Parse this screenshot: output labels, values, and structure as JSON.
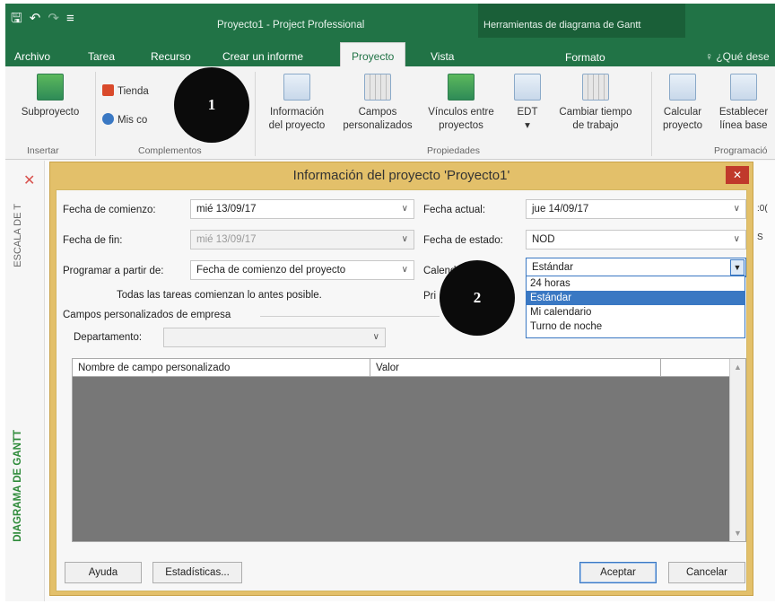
{
  "app": {
    "window_title": "Proyecto1 - Project Professional",
    "contextual_title": "Herramientas de diagrama de Gantt",
    "contextual_tab": "Formato",
    "tell_me": "¿Qué dese",
    "tabs": [
      "Archivo",
      "Tarea",
      "Recurso",
      "Crear un informe",
      "Proyecto",
      "Vista"
    ],
    "active_tab": "Proyecto"
  },
  "ribbon": {
    "subproyecto": "Subproyecto",
    "tienda": "Tienda",
    "mis_complementos": "Mis co",
    "info_proyecto": [
      "Información",
      "del proyecto"
    ],
    "campos_personalizados": [
      "Campos",
      "personalizados"
    ],
    "vinculos": [
      "Vínculos entre",
      "proyectos"
    ],
    "edt": "EDT",
    "cambiar_tiempo": [
      "Cambiar tiempo",
      "de trabajo"
    ],
    "calcular": [
      "Calcular",
      "proyecto"
    ],
    "establecer": [
      "Establecer",
      "línea base"
    ],
    "groups": {
      "insertar": "Insertar",
      "complementos": "Complementos",
      "propiedades": "Propiedades",
      "programacion": "Programació"
    }
  },
  "side": {
    "escala": "ESCALA DE T",
    "gantt": "DIAGRAMA DE GANTT",
    "right_peek_1": ":0(",
    "right_peek_2": "S"
  },
  "markers": {
    "m1": "1",
    "m2": "2"
  },
  "dialog": {
    "title": "Información del proyecto 'Proyecto1'",
    "close": "✕",
    "fecha_comienzo_label": "Fecha de comienzo:",
    "fecha_comienzo_value": "mié 13/09/17",
    "fecha_fin_label": "Fecha de fin:",
    "fecha_fin_value": "mié 13/09/17",
    "programar_label": "Programar a partir de:",
    "programar_value": "Fecha de comienzo del proyecto",
    "note": "Todas las tareas comienzan lo antes posible.",
    "fecha_actual_label": "Fecha actual:",
    "fecha_actual_value": "jue 14/09/17",
    "fecha_estado_label": "Fecha de estado:",
    "fecha_estado_value": "NOD",
    "calendario_label": "Calend",
    "calendario_value": "Estándar",
    "prioridad_label": "Pri",
    "calendar_options": [
      "24 horas",
      "Estándar",
      "Mi calendario",
      "Turno de noche"
    ],
    "calendar_selected_index": 1,
    "campos_section": "Campos personalizados de empresa",
    "departamento_label": "Departamento:",
    "departamento_value": "",
    "col_nombre": "Nombre de campo personalizado",
    "col_valor": "Valor",
    "ayuda": "Ayuda",
    "estadisticas": "Estadísticas...",
    "aceptar": "Aceptar",
    "cancelar": "Cancelar"
  },
  "colors": {
    "ribbon_green": "#217346",
    "dialog_frame": "#e3c06a",
    "selection_blue": "#3a78c3"
  }
}
